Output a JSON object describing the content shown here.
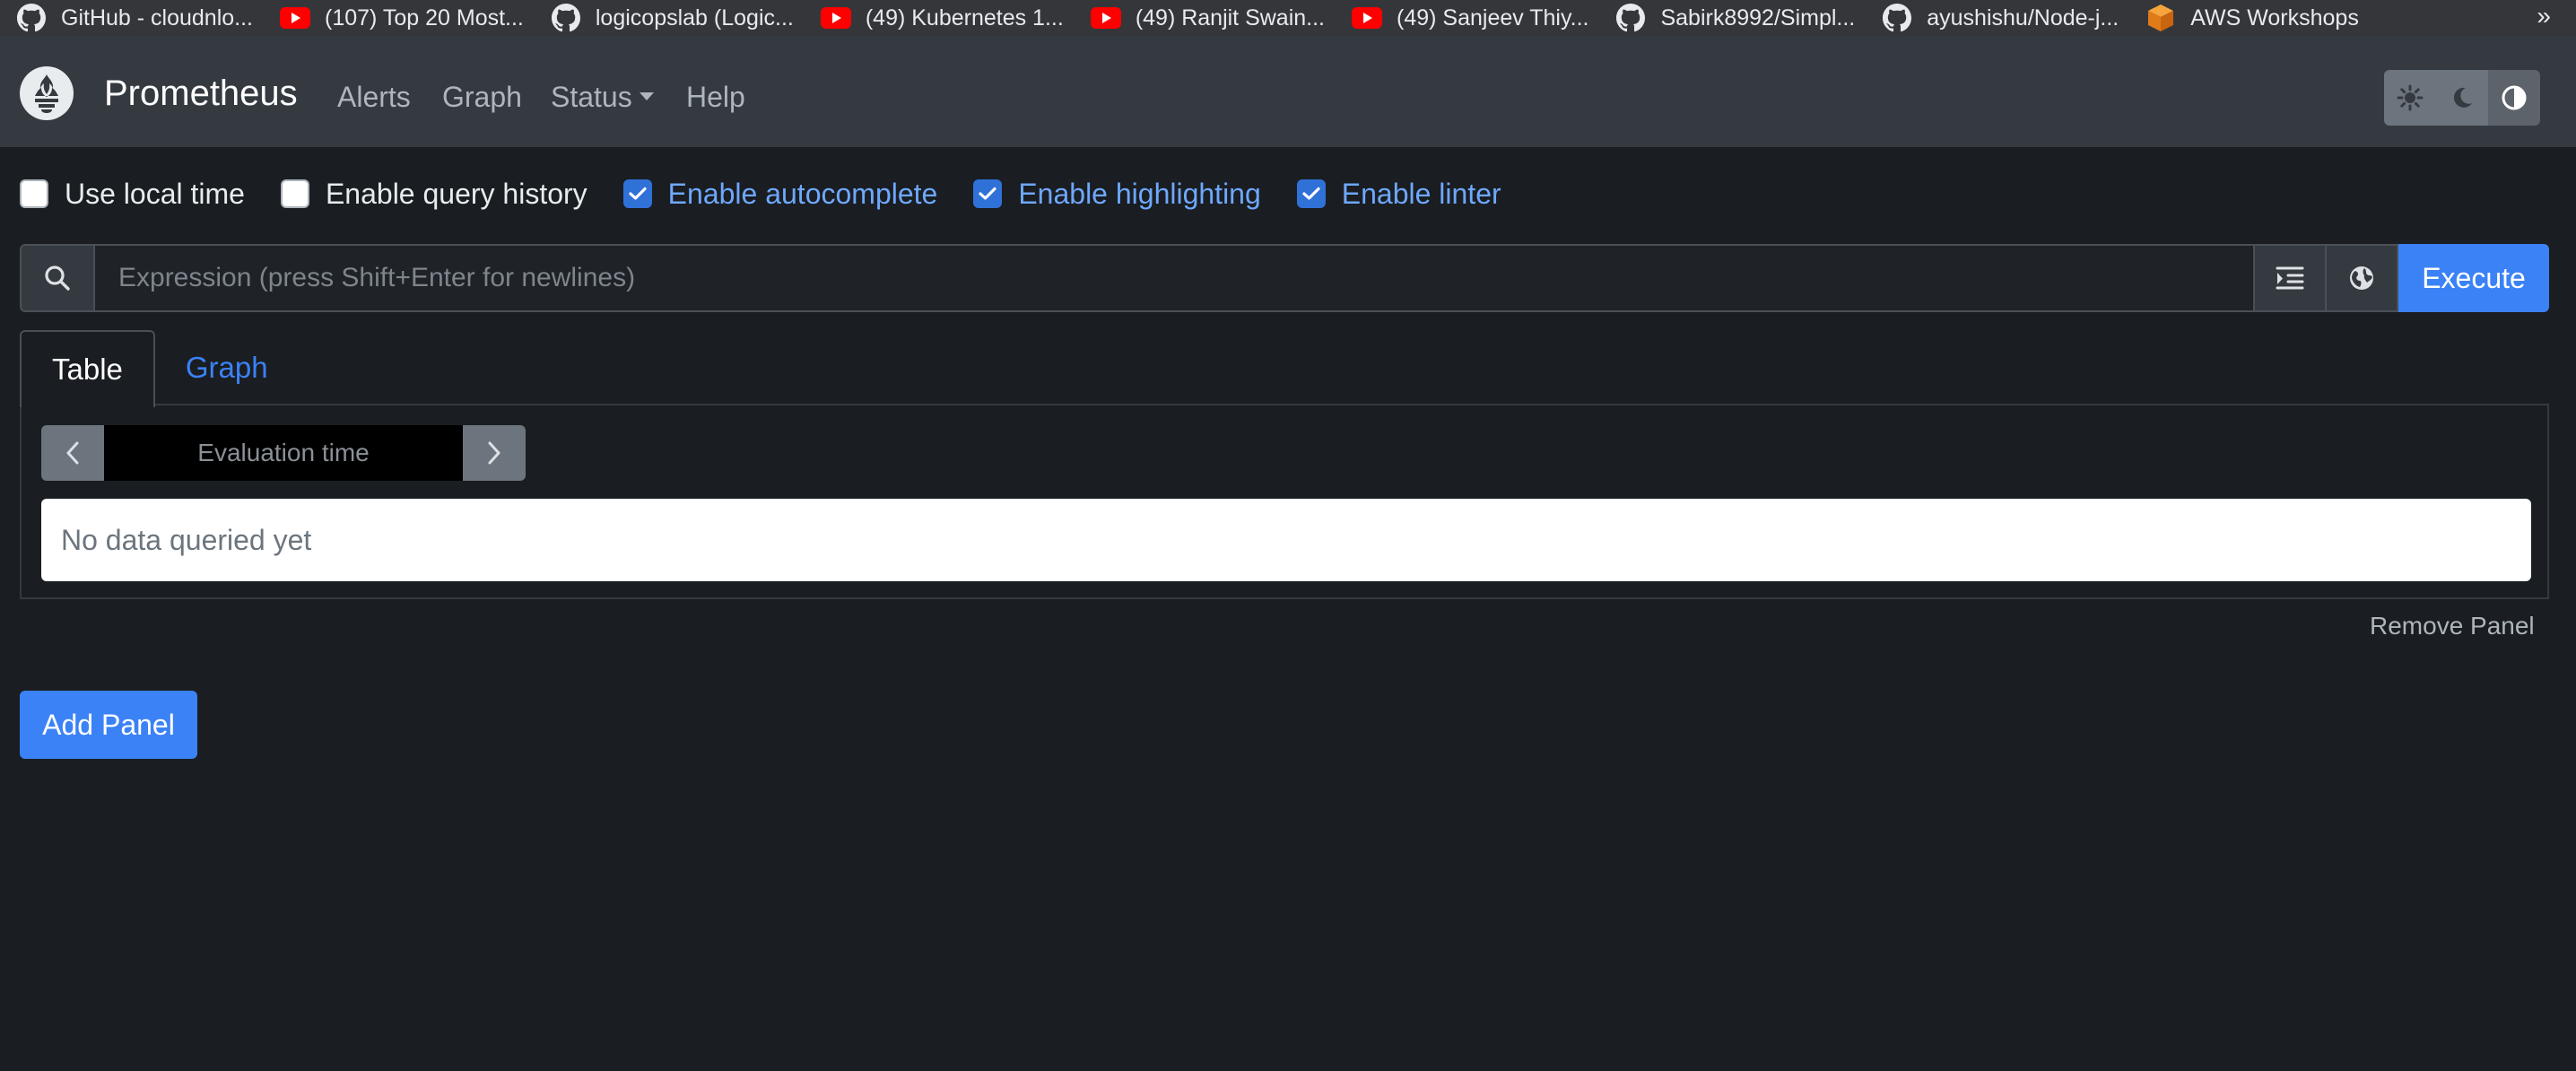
{
  "bookmarks": [
    {
      "label": "GitHub - cloudnlo...",
      "icon": "github-icon"
    },
    {
      "label": "(107) Top 20 Most...",
      "icon": "youtube-icon"
    },
    {
      "label": "logicopslab (Logic...",
      "icon": "github-icon"
    },
    {
      "label": "(49) Kubernetes 1...",
      "icon": "youtube-icon"
    },
    {
      "label": "(49) Ranjit Swain...",
      "icon": "youtube-icon"
    },
    {
      "label": "(49) Sanjeev Thiy...",
      "icon": "youtube-icon"
    },
    {
      "label": "Sabirk8992/Simpl...",
      "icon": "github-icon"
    },
    {
      "label": "ayushishu/Node-j...",
      "icon": "github-icon"
    },
    {
      "label": "AWS Workshops",
      "icon": "aws-box-icon"
    }
  ],
  "bookmarks_more": "»",
  "navbar": {
    "brand": "Prometheus",
    "links": {
      "alerts": "Alerts",
      "graph": "Graph",
      "status": "Status",
      "help": "Help"
    }
  },
  "options": {
    "use_local_time": {
      "label": "Use local time",
      "checked": false
    },
    "query_history": {
      "label": "Enable query history",
      "checked": false
    },
    "autocomplete": {
      "label": "Enable autocomplete",
      "checked": true
    },
    "highlighting": {
      "label": "Enable highlighting",
      "checked": true
    },
    "linter": {
      "label": "Enable linter",
      "checked": true
    }
  },
  "expression": {
    "placeholder": "Expression (press Shift+Enter for newlines)",
    "value": "",
    "execute_label": "Execute"
  },
  "tabs": {
    "table": "Table",
    "graph": "Graph"
  },
  "panel": {
    "eval_placeholder": "Evaluation time",
    "result_text": "No data queried yet",
    "remove_label": "Remove Panel"
  },
  "add_panel_label": "Add Panel",
  "colors": {
    "accent": "#3b82f6",
    "background": "#1a1d21",
    "navbar": "#343a40"
  }
}
